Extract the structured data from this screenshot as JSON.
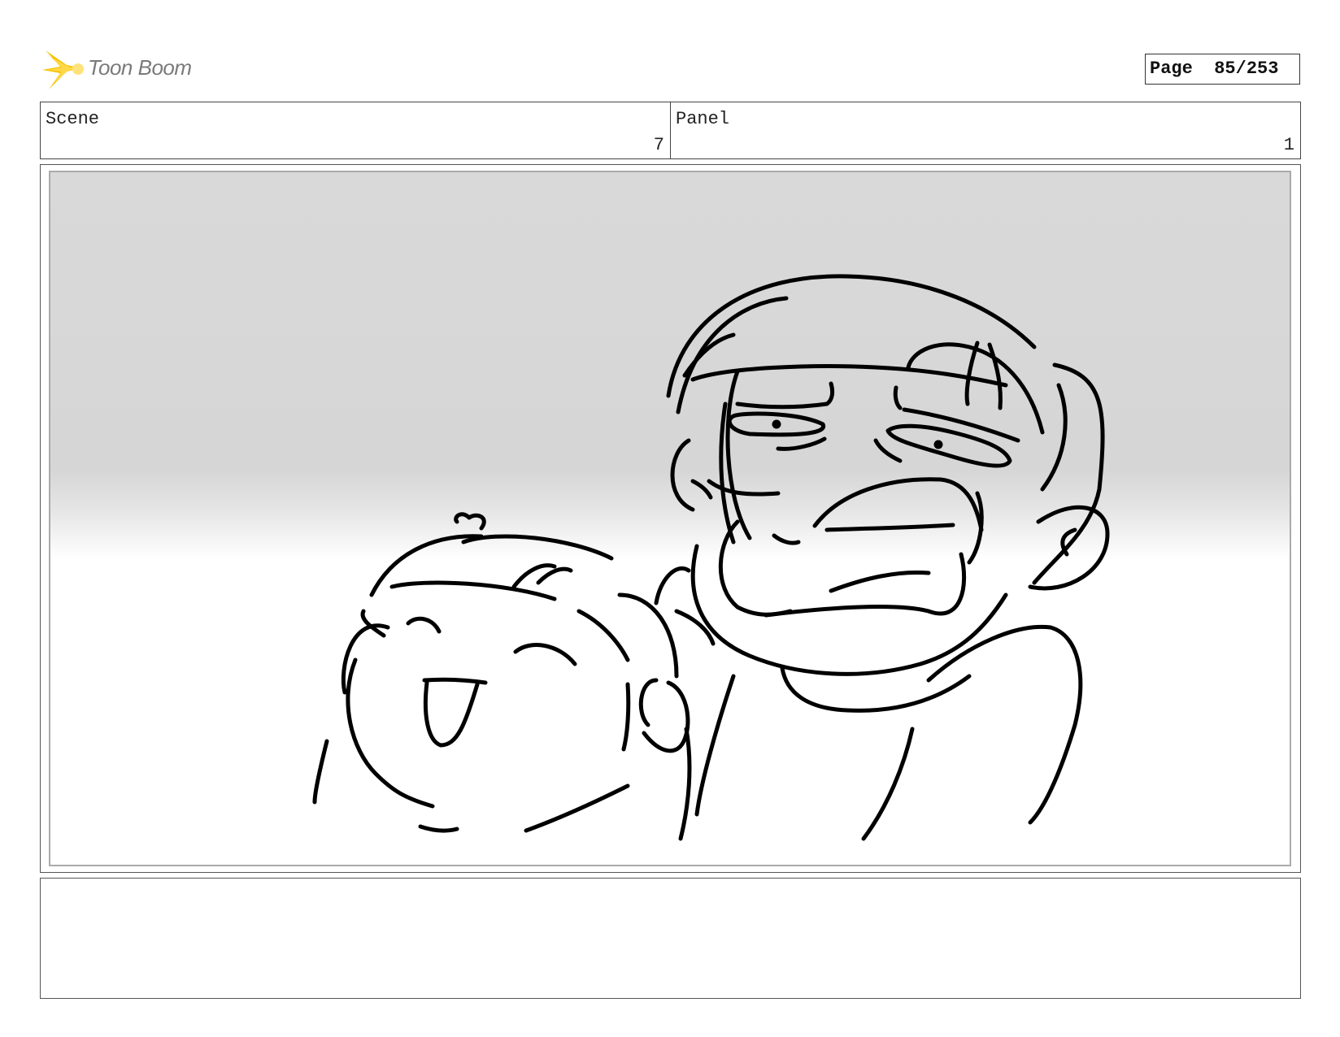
{
  "brand": {
    "name": "Toon Boom",
    "accent": "#f5c400",
    "logo_icon": "starburst-icon"
  },
  "page": {
    "label": "Page",
    "current": "85",
    "total": "253",
    "display": "Page  85/253"
  },
  "header": {
    "scene": {
      "label": "Scene",
      "value": "7"
    },
    "panel": {
      "label": "Panel",
      "value": "1"
    }
  },
  "panel_image": {
    "description_icon": "storyboard-sketch",
    "background": "#d8d8d8"
  },
  "notes": {
    "text": ""
  }
}
